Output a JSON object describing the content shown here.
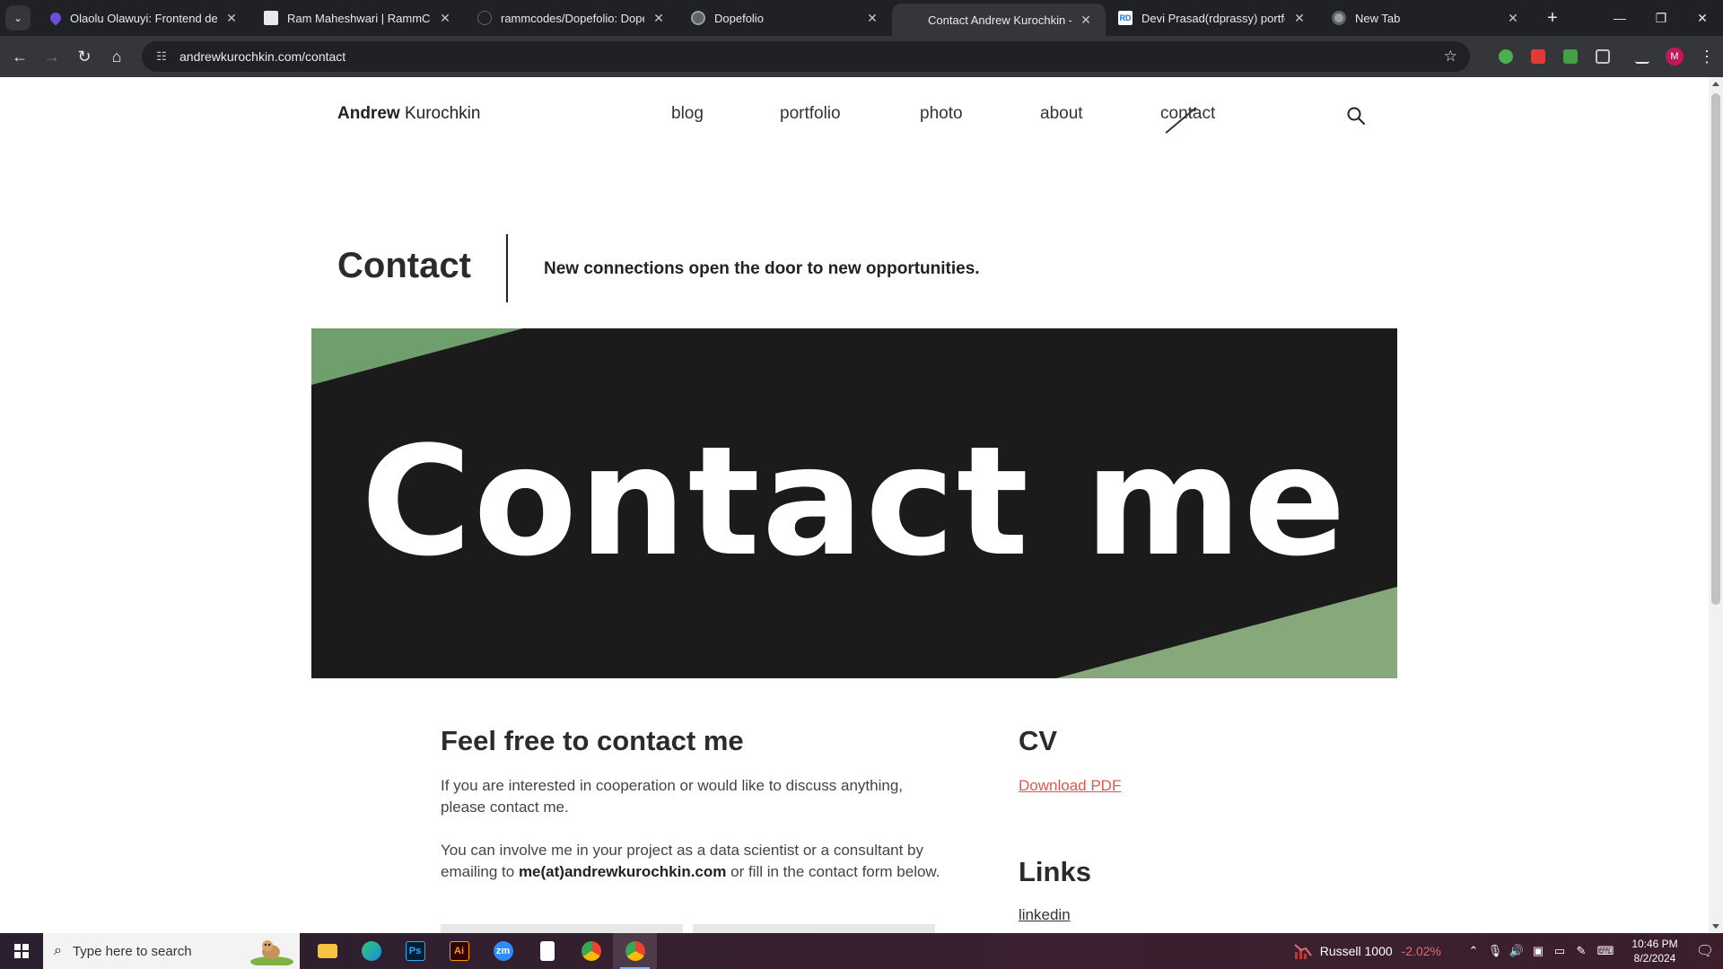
{
  "browser": {
    "tabs": [
      {
        "title": "Olaolu Olawuyi: Frontend deve",
        "favicon_color": "#6c4fd9",
        "favicon_glyph": "",
        "active": false
      },
      {
        "title": "Ram Maheshwari | RammCodes",
        "favicon_color": "#e8eaed",
        "favicon_glyph": "",
        "active": false
      },
      {
        "title": "rammcodes/Dopefolio: Dopefo",
        "favicon_color": "#202124",
        "favicon_glyph": "",
        "active": false
      },
      {
        "title": "Dopefolio",
        "favicon_color": "#5f6368",
        "favicon_glyph": "",
        "active": false
      },
      {
        "title": "Contact Andrew Kurochkin - da",
        "favicon_color": "#35363a",
        "favicon_glyph": "",
        "active": true
      },
      {
        "title": "Devi Prasad(rdprassy) portfolio",
        "favicon_color": "#ffffff",
        "favicon_glyph": "RD",
        "active": false
      },
      {
        "title": "New Tab",
        "favicon_color": "#5f6368",
        "favicon_glyph": "",
        "active": false
      }
    ],
    "url": "andrewkurochkin.com/contact",
    "profile_initial": "M",
    "extension_colors": [
      "#4caf50",
      "#e53935",
      "#43a047",
      "#c4c7c5"
    ]
  },
  "site": {
    "brand_first": "Andrew",
    "brand_last": "Kurochkin",
    "nav": [
      {
        "label": "blog",
        "current": false
      },
      {
        "label": "portfolio",
        "current": false
      },
      {
        "label": "photo",
        "current": false
      },
      {
        "label": "about",
        "current": false
      },
      {
        "label": "contact",
        "current": true
      }
    ],
    "page_title": "Contact",
    "tagline": "New connections open the door to new opportunities.",
    "hero_text": "Contact me",
    "hero_accent": "#6f9f6c",
    "contact": {
      "heading": "Feel free to contact me",
      "para1": "If you are interested in cooperation or would like to discuss anything, please contact me.",
      "para2_before": "You can involve me in your project as a data scientist or a consultant by emailing to ",
      "email": "me(at)andrewkurochkin.com",
      "para2_after": " or fill in the contact form below."
    },
    "cv": {
      "heading": "CV",
      "link": "Download PDF"
    },
    "links": {
      "heading": "Links",
      "items": [
        "linkedin"
      ]
    }
  },
  "taskbar": {
    "search_placeholder": "Type here to search",
    "apps": [
      "File Explorer",
      "Edge",
      "Photoshop",
      "Illustrator",
      "Zoom",
      "Notepad",
      "Chrome",
      "Chrome Profile"
    ],
    "stock_name": "Russell 1000",
    "stock_change": "-2.02%",
    "time": "10:46 PM",
    "date": "8/2/2024"
  }
}
